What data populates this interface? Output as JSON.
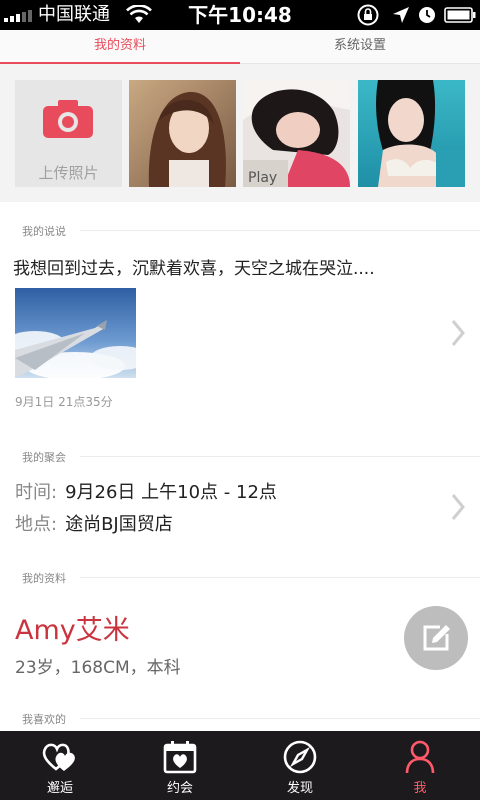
{
  "status_bar": {
    "carrier": "中国联通",
    "time": "下午10:48"
  },
  "tabs": [
    {
      "label": "我的资料",
      "active": true
    },
    {
      "label": "系统设置",
      "active": false
    }
  ],
  "photos": {
    "upload_label": "上传照片"
  },
  "shuoshuo": {
    "section_title": "我的说说",
    "text": "我想回到过去，沉默着欢喜，天空之城在哭泣....",
    "time": "9月1日 21点35分"
  },
  "gathering": {
    "section_title": "我的聚会",
    "time_key": "时间:",
    "time_value": "9月26日  上午10点 - 12点",
    "place_key": "地点:",
    "place_value": "途尚BJ国贸店"
  },
  "profile": {
    "section_title": "我的资料",
    "name": "Amy艾米",
    "bio": "23岁，168CM，本科"
  },
  "likes": {
    "section_title": "我喜欢的"
  },
  "bottom_nav": [
    {
      "label": "邂逅",
      "icon": "hearts-icon",
      "active": false
    },
    {
      "label": "约会",
      "icon": "calendar-heart-icon",
      "active": false
    },
    {
      "label": "发现",
      "icon": "compass-icon",
      "active": false
    },
    {
      "label": "我",
      "icon": "person-icon",
      "active": true
    }
  ],
  "colors": {
    "accent": "#e84c5c",
    "name_red": "#c9343f",
    "nav_bg": "#1c1a1c"
  }
}
